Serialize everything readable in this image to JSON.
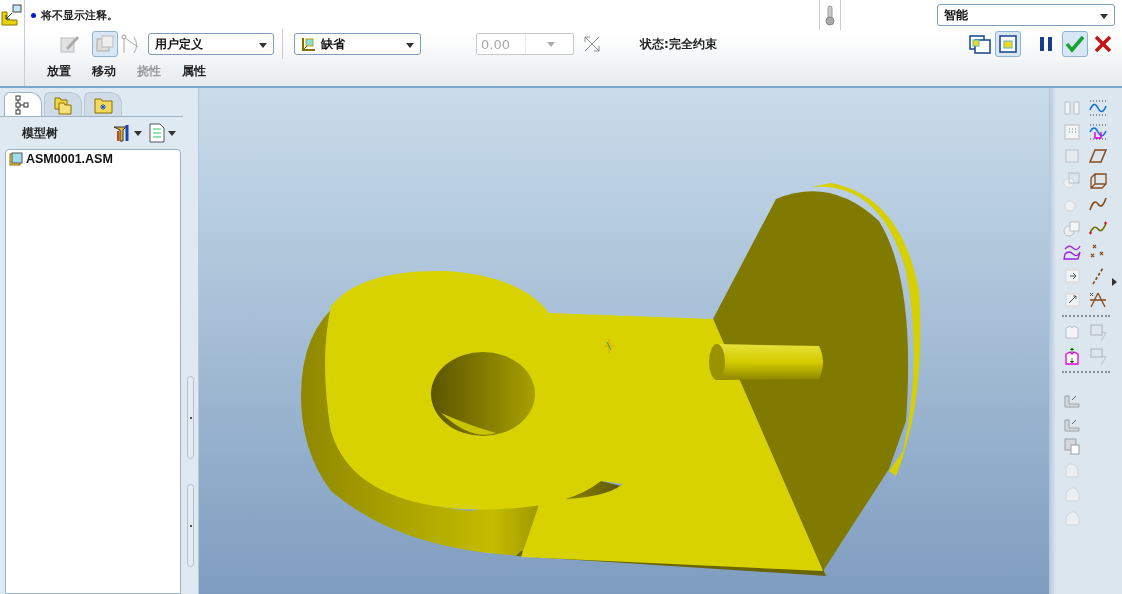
{
  "message": "将不显示注释。",
  "constraint_type": {
    "value": "用户定义"
  },
  "offset_type": {
    "value": "缺省"
  },
  "offset_value": {
    "value": "0.00",
    "disabled": true
  },
  "status": "状态:完全约束",
  "smart_select": {
    "value": "智能"
  },
  "dashboard_tabs": [
    {
      "label": "放置",
      "disabled": false
    },
    {
      "label": "移动",
      "disabled": false
    },
    {
      "label": "挠性",
      "disabled": true
    },
    {
      "label": "属性",
      "disabled": false
    }
  ],
  "panel_tabs": [
    {
      "selected": true
    },
    {
      "selected": false
    },
    {
      "selected": false
    }
  ],
  "model_tree": {
    "title": "模型树",
    "items": [
      {
        "label": "ASM0001.ASM"
      }
    ]
  }
}
